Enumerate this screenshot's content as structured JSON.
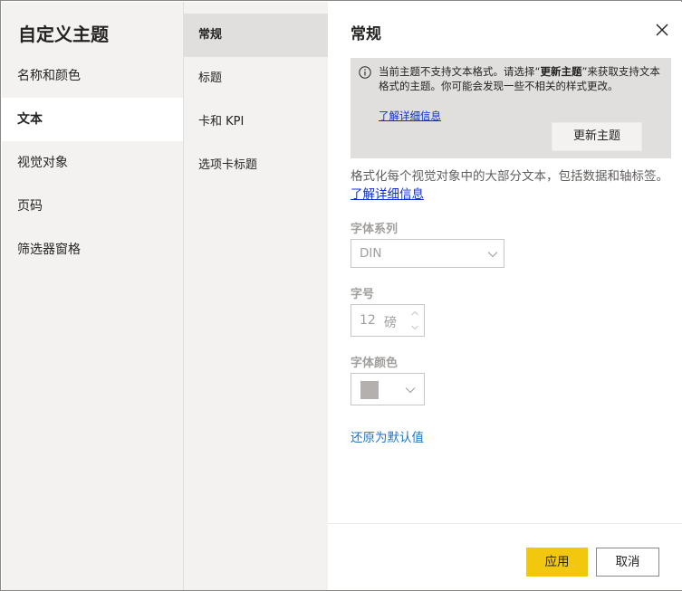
{
  "dialog": {
    "title": "自定义主题"
  },
  "nav_primary": {
    "items": [
      {
        "label": "名称和颜色"
      },
      {
        "label": "文本"
      },
      {
        "label": "视觉对象"
      },
      {
        "label": "页码"
      },
      {
        "label": "筛选器窗格"
      }
    ],
    "active_index": 1
  },
  "nav_secondary": {
    "items": [
      {
        "label": "常规"
      },
      {
        "label": "标题"
      },
      {
        "label": "卡和 KPI"
      },
      {
        "label": "选项卡标题"
      }
    ],
    "active_index": 0
  },
  "pane": {
    "title": "常规",
    "close_icon": "close-icon",
    "notice": {
      "icon": "info-icon",
      "text_before": "当前主题不支持文本格式。请选择“",
      "text_bold": "更新主题",
      "text_after": "”来获取支持文本格式的主题。你可能会发现一些不相关的样式更改。",
      "link": "了解详细信息",
      "button": "更新主题"
    },
    "description": "格式化每个视觉对象中的大部分文本，包括数据和轴标签。",
    "description_link": "了解详细信息",
    "font_family": {
      "label": "字体系列",
      "value": "DIN"
    },
    "font_size": {
      "label": "字号",
      "value": "12",
      "unit": "磅"
    },
    "font_color": {
      "label": "字体颜色",
      "swatch": "#b3b0ad"
    },
    "reset_link": "还原为默认值"
  },
  "footer": {
    "apply": "应用",
    "cancel": "取消"
  },
  "colors": {
    "accent": "#f2c80f",
    "link": "#0d2cd6",
    "nav_bg": "#f3f2f1"
  }
}
